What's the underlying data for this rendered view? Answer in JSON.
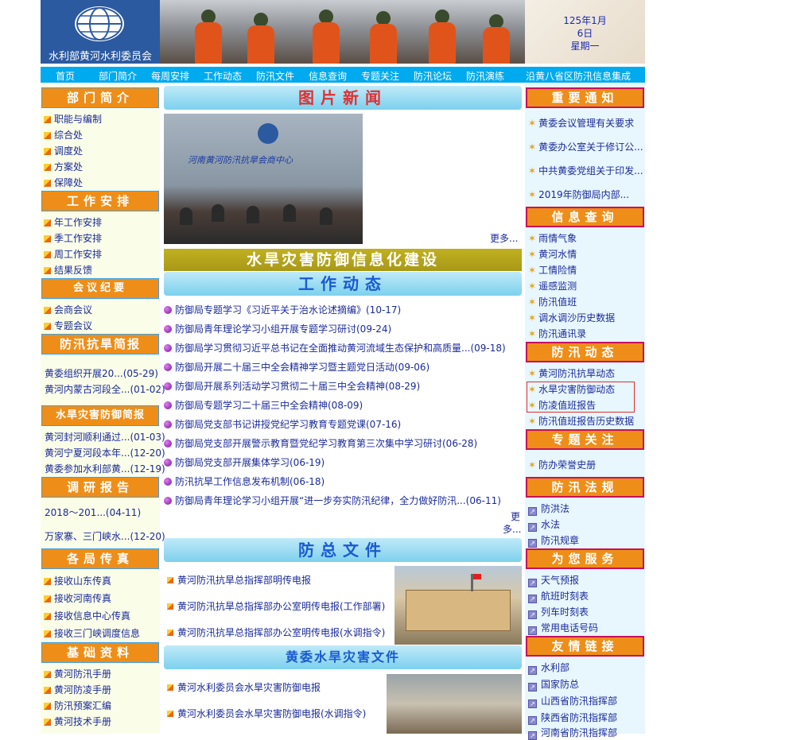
{
  "header": {
    "logo_text": "水利部黄河水利委员会",
    "date_line1": "125年1月",
    "date_line2": "6日",
    "date_line3": "星期一"
  },
  "nav": [
    "首页",
    "部门简介",
    "每周安排",
    "工作动态",
    "防汛文件",
    "信息查询",
    "专题关注",
    "防汛论坛",
    "防汛演练",
    "沿黄八省区防汛信息集成"
  ],
  "left": {
    "dept_title": "部门简介",
    "dept_items": [
      "职能与编制",
      "综合处",
      "调度处",
      "方案处",
      "保障处"
    ],
    "work_title": "工作安排",
    "work_items": [
      "年工作安排",
      "季工作安排",
      "周工作安排",
      "结果反馈"
    ],
    "meeting_title": "会议纪要",
    "meeting_items": [
      "会商会议",
      "专题会议"
    ],
    "brief_title": "防汛抗旱简报",
    "brief_items": [
      "黄委组织开展20...(05-29)",
      "黄河内蒙古河段全...(01-02)"
    ],
    "hazard_title": "水旱灾害防御简报",
    "hazard_items": [
      "黄河封河顺利通过...(01-03)",
      "黄河宁夏河段本年...(12-20)",
      "黄委参加水利部黄...(12-19)"
    ],
    "research_title": "调研报告",
    "research_items": [
      "2018～201...(04-11)",
      "万家寨、三门峡水...(12-20)"
    ],
    "fax_title": "各局传真",
    "fax_items": [
      "接收山东传真",
      "接收河南传真",
      "接收信息中心传真",
      "接收三门峡调度信息"
    ],
    "basic_title": "基础资料",
    "basic_items": [
      "黄河防汛手册",
      "黄河防凌手册",
      "防汛预案汇编",
      "黄河技术手册"
    ]
  },
  "main": {
    "photo_news_title": "图片新闻",
    "photo_sign": "河南黄河防汛抗旱会商中心",
    "more": "更多...",
    "hazard_banner": "水旱灾害防御信息化建设",
    "dynamics_title": "工作动态",
    "dynamics": [
      "防御局专题学习《习近平关于治水论述摘编》(10-17)",
      "防御局青年理论学习小组开展专题学习研讨(09-24)",
      "防御局学习贯彻习近平总书记在全面推动黄河流域生态保护和高质量...(09-18)",
      "防御局开展二十届三中全会精神学习暨主题党日活动(09-06)",
      "防御局开展系列活动学习贯彻二十届三中全会精神(08-29)",
      "防御局专题学习二十届三中全会精神(08-09)",
      "防御局党支部书记讲授党纪学习教育专题党课(07-16)",
      "防御局党支部开展警示教育暨党纪学习教育第三次集中学习研讨(06-28)",
      "防御局党支部开展集体学习(06-19)",
      "防汛抗旱工作信息发布机制(06-18)",
      "防御局青年理论学习小组开展“进一步夯实防汛纪律，全力做好防汛...(06-11)"
    ],
    "more_a": "更",
    "more_b": "多...",
    "docs_title": "防总文件",
    "docs": [
      "黄河防汛抗旱总指挥部明传电报",
      "黄河防汛抗旱总指挥部办公室明传电报(工作部署)",
      "黄河防汛抗旱总指挥部办公室明传电报(水调指令)"
    ],
    "yrcc_title": "黄委水旱灾害文件",
    "yrcc_docs": [
      "黄河水利委员会水旱灾害防御电报",
      "黄河水利委员会水旱灾害防御电报(水调指令)"
    ]
  },
  "right": {
    "notice_title": "重要通知",
    "notices": [
      "黄委会议管理有关要求",
      "黄委办公室关于修订公...",
      "中共黄委党组关于印发...",
      "2019年防御局内部..."
    ],
    "query_title": "信息查询",
    "queries": [
      "雨情气象",
      "黄河水情",
      "工情险情",
      "遥感监测",
      "防汛值班",
      "调水调沙历史数据",
      "防汛通讯录"
    ],
    "dyn_title": "防汛动态",
    "dyns": [
      "黄河防汛抗旱动态",
      "水旱灾害防御动态",
      "防凌值班报告",
      "防汛值班报告历史数据"
    ],
    "topic_title": "专题关注",
    "topics": [
      "防办荣誉史册"
    ],
    "law_title": "防汛法规",
    "laws": [
      "防洪法",
      "水法",
      "防汛规章"
    ],
    "service_title": "为您服务",
    "services": [
      "天气预报",
      "航班时刻表",
      "列车时刻表",
      "常用电话号码"
    ],
    "links_title": "友情链接",
    "links": [
      "水利部",
      "国家防总",
      "山西省防汛指挥部",
      "陕西省防汛指挥部",
      "河南省防汛指挥部"
    ]
  }
}
